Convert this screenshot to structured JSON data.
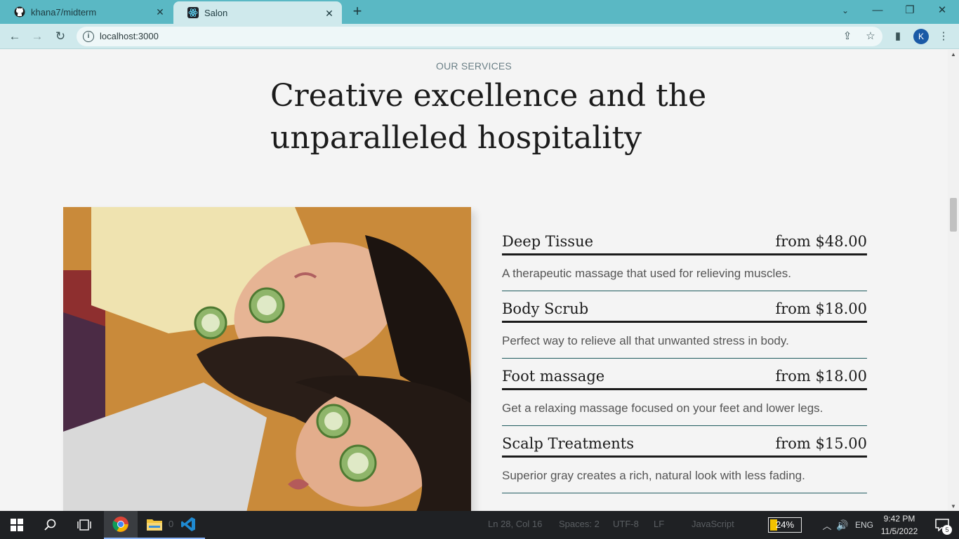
{
  "browser": {
    "tabs": [
      {
        "title": "khana7/midterm",
        "icon": "github-icon"
      },
      {
        "title": "Salon",
        "icon": "react-icon",
        "active": true
      }
    ],
    "url": "localhost:3000",
    "profile_initial": "K",
    "accent_color": "#5ab8c4"
  },
  "page": {
    "eyebrow": "OUR SERVICES",
    "headline": "Creative excellence and the unparalleled hospitality",
    "services": [
      {
        "name": "Deep Tissue",
        "price": "from $48.00",
        "description": "A therapeutic massage that used for relieving muscles."
      },
      {
        "name": "Body Scrub",
        "price": "from $18.00",
        "description": "Perfect way to relieve all that unwanted stress in body."
      },
      {
        "name": "Foot massage",
        "price": "from $18.00",
        "description": "Get a relaxing massage focused on your feet and lower legs."
      },
      {
        "name": "Scalp Treatments",
        "price": "from $15.00",
        "description": "Superior gray creates a rich, natural look with less fading."
      }
    ]
  },
  "taskbar": {
    "status_ln_col": "Ln 28, Col 16",
    "status_spaces": "Spaces: 2",
    "status_encoding": "UTF-8",
    "status_eol": "LF",
    "status_lang": "JavaScript",
    "battery": "24%",
    "battery_level": 0.24,
    "language": "ENG",
    "time": "9:42 PM",
    "date": "11/5/2022",
    "notifications": "5",
    "explorer_badge": "0"
  }
}
